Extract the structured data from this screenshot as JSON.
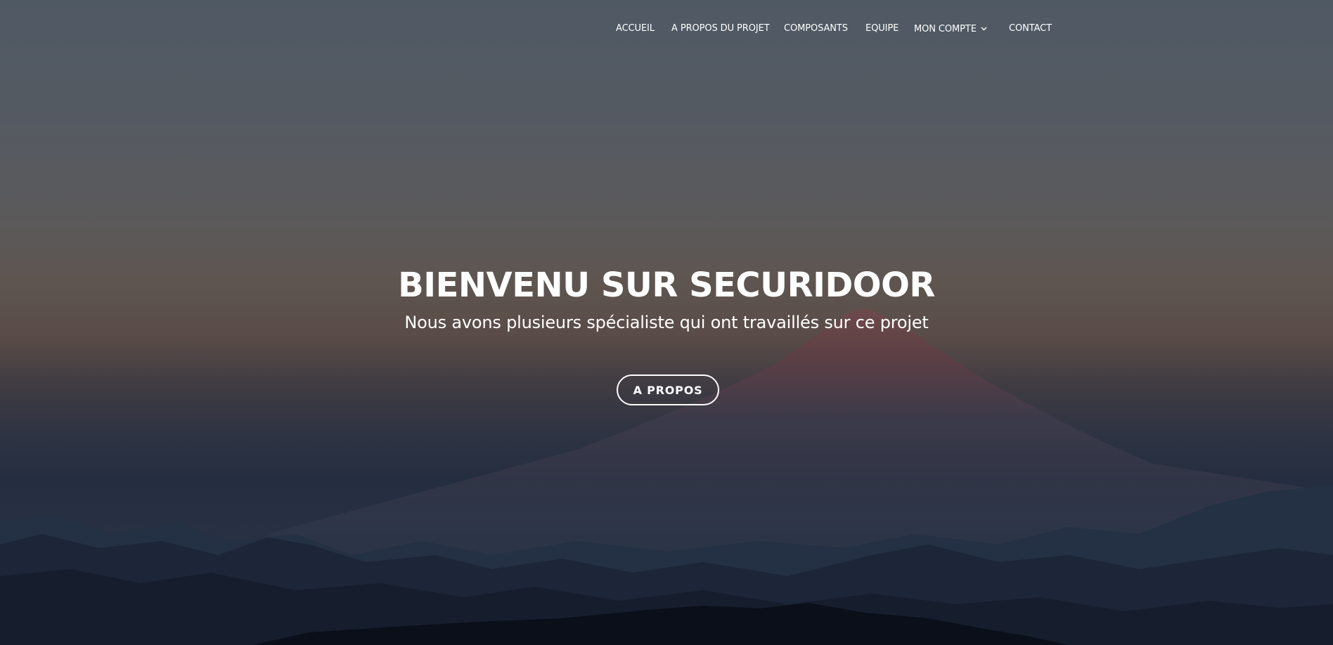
{
  "nav": {
    "items": [
      {
        "label": "ACCUEIL"
      },
      {
        "label": "A PROPOS DU PROJET"
      },
      {
        "label": "COMPOSANTS"
      },
      {
        "label": "EQUIPE"
      },
      {
        "label": "MON COMPTE",
        "icon": "chevron-down-icon"
      },
      {
        "label": "CONTACT"
      }
    ]
  },
  "hero": {
    "title": "BIENVENU SUR SECURIDOOR",
    "subtitle": "Nous avons plusieurs spécialiste qui ont travaillés sur ce projet",
    "button_label": "A PROPOS",
    "background_image": "mountain-silhouette-dusk"
  },
  "colors": {
    "text": "#ffffff",
    "sky_top": "#4f5964",
    "horizon": "#5a4c48",
    "mountains": "#121a2a"
  }
}
